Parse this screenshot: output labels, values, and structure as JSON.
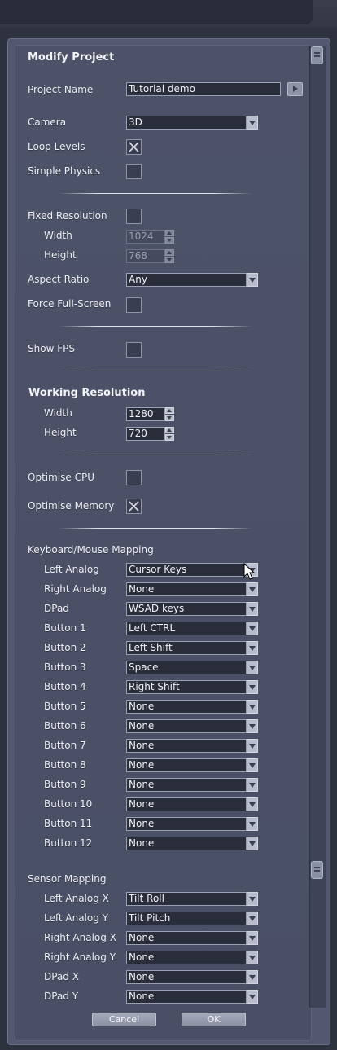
{
  "title": "Modify Project",
  "project_name": {
    "label": "Project Name",
    "value": "Tutorial demo"
  },
  "camera": {
    "label": "Camera",
    "value": "3D"
  },
  "loop_levels": {
    "label": "Loop Levels",
    "checked": true
  },
  "simple_physics": {
    "label": "Simple Physics",
    "checked": false
  },
  "fixed_resolution": {
    "label": "Fixed Resolution",
    "checked": false,
    "width_label": "Width",
    "width": "1024",
    "height_label": "Height",
    "height": "768"
  },
  "aspect_ratio": {
    "label": "Aspect Ratio",
    "value": "Any"
  },
  "force_fullscreen": {
    "label": "Force Full-Screen",
    "checked": false
  },
  "show_fps": {
    "label": "Show FPS",
    "checked": false
  },
  "working_resolution": {
    "title": "Working Resolution",
    "width_label": "Width",
    "width": "1280",
    "height_label": "Height",
    "height": "720"
  },
  "optimise_cpu": {
    "label": "Optimise CPU",
    "checked": false
  },
  "optimise_memory": {
    "label": "Optimise Memory",
    "checked": true
  },
  "keyboard_mapping": {
    "title": "Keyboard/Mouse Mapping",
    "rows": [
      {
        "label": "Left Analog",
        "value": "Cursor Keys"
      },
      {
        "label": "Right Analog",
        "value": "None"
      },
      {
        "label": "DPad",
        "value": "WSAD keys"
      },
      {
        "label": "Button 1",
        "value": "Left CTRL"
      },
      {
        "label": "Button 2",
        "value": "Left Shift"
      },
      {
        "label": "Button 3",
        "value": "Space"
      },
      {
        "label": "Button 4",
        "value": "Right Shift"
      },
      {
        "label": "Button 5",
        "value": "None"
      },
      {
        "label": "Button 6",
        "value": "None"
      },
      {
        "label": "Button 7",
        "value": "None"
      },
      {
        "label": "Button 8",
        "value": "None"
      },
      {
        "label": "Button 9",
        "value": "None"
      },
      {
        "label": "Button 10",
        "value": "None"
      },
      {
        "label": "Button 11",
        "value": "None"
      },
      {
        "label": "Button 12",
        "value": "None"
      }
    ]
  },
  "sensor_mapping": {
    "title": "Sensor Mapping",
    "rows": [
      {
        "label": "Left Analog X",
        "value": "Tilt Roll"
      },
      {
        "label": "Left Analog Y",
        "value": "Tilt Pitch"
      },
      {
        "label": "Right Analog X",
        "value": "None"
      },
      {
        "label": "Right Analog Y",
        "value": "None"
      },
      {
        "label": "DPad X",
        "value": "None"
      },
      {
        "label": "DPad Y",
        "value": "None"
      }
    ]
  },
  "buttons": {
    "cancel": "Cancel",
    "ok": "OK"
  },
  "colors": {
    "panel": "#535870",
    "field_bg": "#2a2d3a",
    "background": "#2e313e"
  }
}
